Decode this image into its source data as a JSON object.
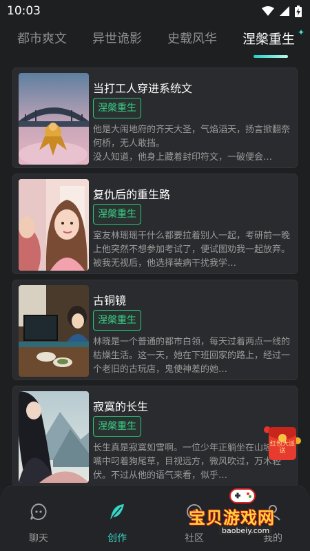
{
  "status_bar": {
    "time": "10:03",
    "icons": [
      "wifi-icon",
      "cellular-signal-icon",
      "battery-charging-icon"
    ]
  },
  "tabs": [
    {
      "label": "都市爽文",
      "active": false
    },
    {
      "label": "异世诡影",
      "active": false
    },
    {
      "label": "史载风华",
      "active": false
    },
    {
      "label": "涅槃重生",
      "active": true
    }
  ],
  "novels": [
    {
      "title": "当打工人穿进系统文",
      "tag": "涅槃重生",
      "description": "他是大闹地府的齐天大圣，气焰滔天，扬言掀翻奈何桥，无人敢挡。\n没人知道，他身上藏着封印符文，一破便会…"
    },
    {
      "title": "复仇后的重生路",
      "tag": "涅槃重生",
      "description": "室友林瑶瑶干什么都要拉着别人一起，考研前一晚上他突然不想参加考试了，便试图劝我一起放弃。被我无视后，他选择装病干扰我学…"
    },
    {
      "title": "古铜镜",
      "tag": "涅槃重生",
      "description": "林晓是一个普通的都市白领，每天过着两点一线的枯燥生活。这一天，她在下班回家的路上，经过一个老旧的古玩店，鬼使神差的她…"
    },
    {
      "title": "寂寞的长生",
      "tag": "涅槃重生",
      "description": "长生真是寂寞如雪啊。一位少年正躺坐在山坡上，嘴中叼着狗尾草，目视远方，微风吹过，万木轻伏。不过从他的语气来看，似乎…"
    }
  ],
  "bottom_nav": [
    {
      "label": "聊天",
      "icon": "chat-bubble-icon",
      "active": false
    },
    {
      "label": "创作",
      "icon": "feather-pen-icon",
      "active": true
    },
    {
      "label": "社区",
      "icon": "community-icon",
      "active": false
    },
    {
      "label": "我的",
      "icon": "profile-icon",
      "active": false
    }
  ],
  "floating_red_packet": {
    "text": "红包大派送"
  },
  "watermark": {
    "main": "宝贝游戏网",
    "sub": "baobeiy.com"
  },
  "colors": {
    "background": "#1e1f21",
    "card": "#2a2b2e",
    "accent": "#36d6c6",
    "tag_green": "#3ad186"
  }
}
